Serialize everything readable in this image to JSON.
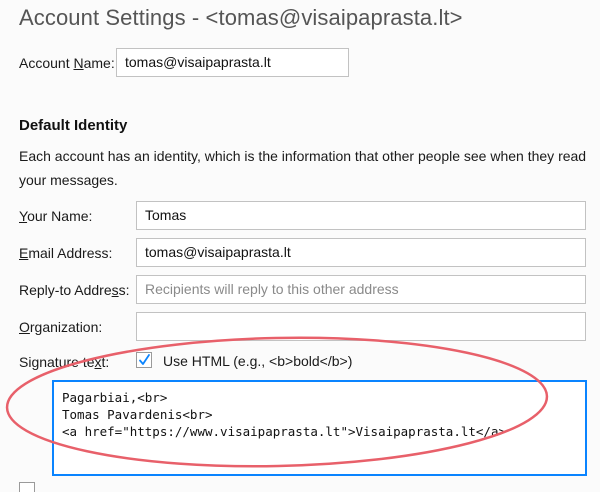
{
  "header": {
    "title": "Account Settings - <tomas@visaipaprasta.lt>"
  },
  "account": {
    "label_pre": "Account ",
    "label_key": "N",
    "label_post": "ame:",
    "value": "tomas@visaipaprasta.lt"
  },
  "identity": {
    "section_title": "Default Identity",
    "description": "Each account has an identity, which is the information that other people see when they read your messages.",
    "your_name": {
      "label_pre": "",
      "label_key": "Y",
      "label_post": "our Name:",
      "value": "Tomas"
    },
    "email": {
      "label_pre": "",
      "label_key": "E",
      "label_post": "mail Address:",
      "value": "tomas@visaipaprasta.lt"
    },
    "reply_to": {
      "label_pre": "Reply-to Addre",
      "label_key": "s",
      "label_post": "s:",
      "placeholder": "Recipients will reply to this other address"
    },
    "organization": {
      "label_pre": "",
      "label_key": "O",
      "label_post": "rganization:",
      "value": ""
    },
    "signature": {
      "label_pre": "Signature te",
      "label_key": "x",
      "label_post": "t:",
      "use_html_label": "Use HTML (e.g., <b>bold</b>)",
      "use_html_checked": true,
      "text": "Pagarbiai,<br>\nTomas Pavardenis<br>\n<a href=\"https://www.visaipaprasta.lt\">Visaipaprasta.lt</a>"
    }
  },
  "colors": {
    "focus_border": "#0a84ff",
    "annotation_ellipse": "#e8606a",
    "checkmark": "#0a84ff"
  },
  "icons": {
    "checkbox": "checkmark-icon"
  }
}
